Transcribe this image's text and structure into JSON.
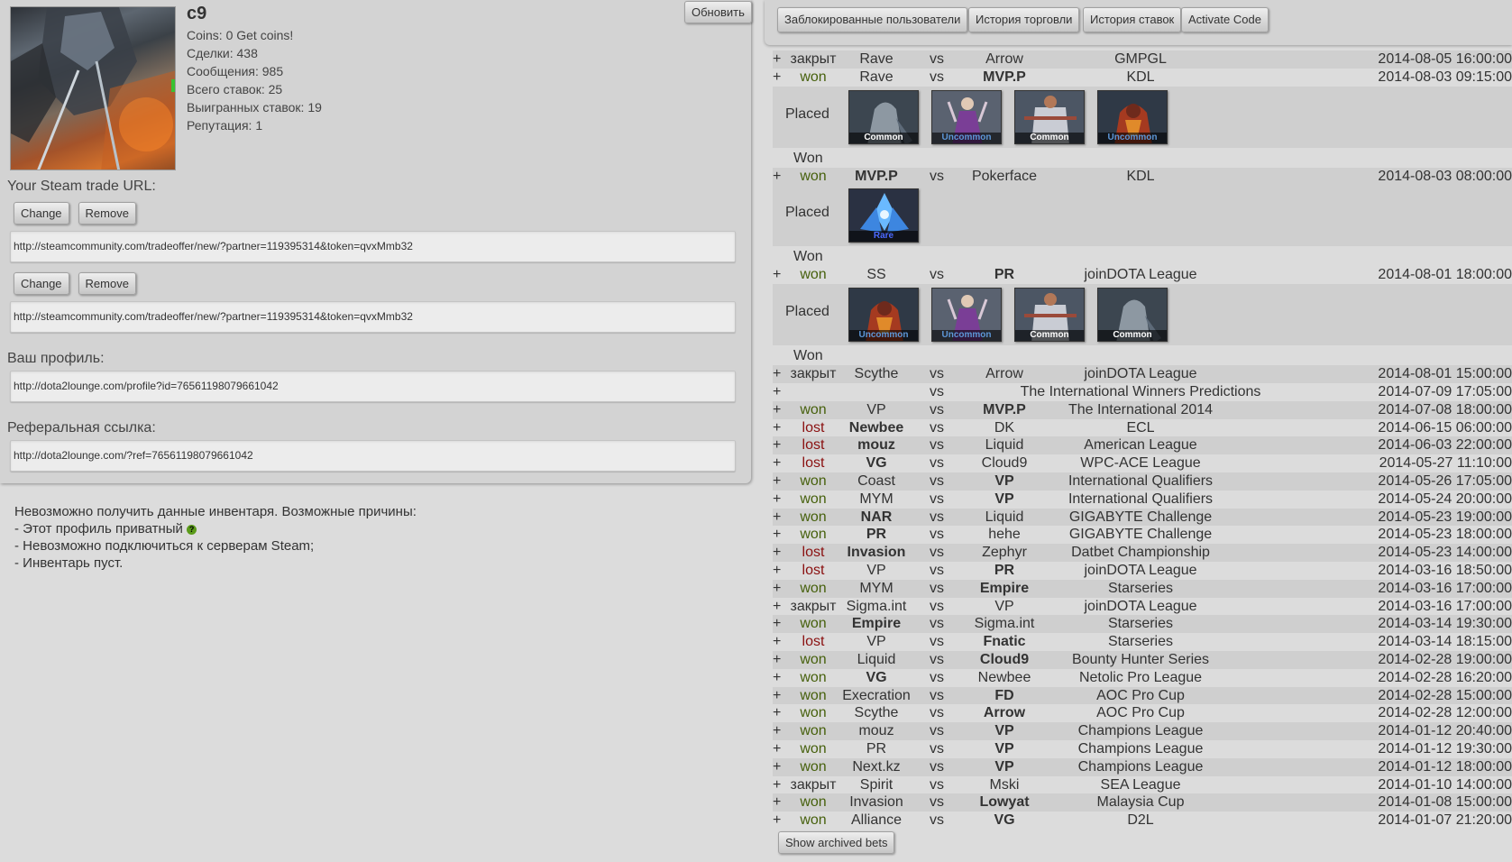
{
  "profile": {
    "username": "c9",
    "coins": "Coins: 0 Get coins!",
    "deals": "Сделки: 438",
    "messages": "Сообщения: 985",
    "total_bets": "Всего ставок: 25",
    "won_bets": "Выигранных ставок: 19",
    "reputation": "Репутация: 1",
    "refresh_label": "Обновить"
  },
  "trade": {
    "label": "Your Steam trade URL:",
    "change_label": "Change",
    "remove_label": "Remove",
    "url1": "http://steamcommunity.com/tradeoffer/new/?partner=119395314&token=qvxMmb32",
    "url2": "http://steamcommunity.com/tradeoffer/new/?partner=119395314&token=qvxMmb32"
  },
  "profile_link": {
    "label": "Ваш профиль:",
    "url": "http://dota2lounge.com/profile?id=76561198079661042"
  },
  "referral": {
    "label": "Реферальная ссылка:",
    "url": "http://dota2lounge.com/?ref=76561198079661042"
  },
  "inventory": {
    "line1": "Невозможно получить данные инвентаря. Возможные причины:",
    "line2": "- Этот профиль приватный",
    "line3": "- Невозможно подключиться к серверам Steam;",
    "line4": "- Инвентарь пуст."
  },
  "nav": {
    "blocked": "Заблокированные пользователи",
    "trade_history": "История торговли",
    "bet_history": "История ставок",
    "activate": "Activate Code"
  },
  "labels": {
    "placed": "Placed",
    "won": "Won",
    "vs": "vs",
    "plus": "+",
    "archived": "Show archived bets"
  },
  "colors": {
    "won": "#46600c",
    "lost": "#8a1010",
    "common": "#ffffff",
    "uncommon": "#5e98d9",
    "rare": "#4b69ff"
  },
  "bets": [
    {
      "status": "закрыт",
      "t1": "Rave",
      "t2": "Arrow",
      "league": "GMPGL",
      "date": "2014-08-05 16:00:00",
      "win": 0
    },
    {
      "status": "won",
      "t1": "Rave",
      "t2": "MVP.P",
      "league": "KDL",
      "date": "2014-08-03 09:15:00",
      "win": 2,
      "items": [
        {
          "rarity": "Common",
          "hero": "ghost"
        },
        {
          "rarity": "Uncommon",
          "hero": "purple"
        },
        {
          "rarity": "Common",
          "hero": "white"
        },
        {
          "rarity": "Uncommon",
          "hero": "red"
        }
      ]
    },
    {
      "status": "won",
      "t1": "MVP.P",
      "t2": "Pokerface",
      "league": "KDL",
      "date": "2014-08-03 08:00:00",
      "win": 1,
      "items": [
        {
          "rarity": "Rare",
          "hero": "blue"
        }
      ]
    },
    {
      "status": "won",
      "t1": "SS",
      "t2": "PR",
      "league": "joinDOTA League",
      "date": "2014-08-01 18:00:00",
      "win": 2,
      "items": [
        {
          "rarity": "Uncommon",
          "hero": "red"
        },
        {
          "rarity": "Uncommon",
          "hero": "purple"
        },
        {
          "rarity": "Common",
          "hero": "white"
        },
        {
          "rarity": "Common",
          "hero": "ghost"
        }
      ]
    },
    {
      "status": "закрыт",
      "t1": "Scythe",
      "t2": "Arrow",
      "league": "joinDOTA League",
      "date": "2014-08-01 15:00:00",
      "win": 0
    },
    {
      "status": "",
      "t1": "",
      "t2": "",
      "league": "The International Winners Predictions",
      "date": "2014-07-09 17:05:00",
      "win": 0
    },
    {
      "status": "won",
      "t1": "VP",
      "t2": "MVP.P",
      "league": "The International 2014",
      "date": "2014-07-08 18:00:00",
      "win": 2
    },
    {
      "status": "lost",
      "t1": "Newbee",
      "t2": "DK",
      "league": "ECL",
      "date": "2014-06-15 06:00:00",
      "win": 1
    },
    {
      "status": "lost",
      "t1": "mouz",
      "t2": "Liquid",
      "league": "American League",
      "date": "2014-06-03 22:00:00",
      "win": 1
    },
    {
      "status": "lost",
      "t1": "VG",
      "t2": "Cloud9",
      "league": "WPC-ACE League",
      "date": "2014-05-27 11:10:00",
      "win": 1
    },
    {
      "status": "won",
      "t1": "Coast",
      "t2": "VP",
      "league": "International Qualifiers",
      "date": "2014-05-26 17:05:00",
      "win": 2
    },
    {
      "status": "won",
      "t1": "MYM",
      "t2": "VP",
      "league": "International Qualifiers",
      "date": "2014-05-24 20:00:00",
      "win": 2
    },
    {
      "status": "won",
      "t1": "NAR",
      "t2": "Liquid",
      "league": "GIGABYTE Challenge",
      "date": "2014-05-23 19:00:00",
      "win": 1
    },
    {
      "status": "won",
      "t1": "PR",
      "t2": "hehe",
      "league": "GIGABYTE Challenge",
      "date": "2014-05-23 18:00:00",
      "win": 1
    },
    {
      "status": "lost",
      "t1": "Invasion",
      "t2": "Zephyr",
      "league": "Datbet Championship",
      "date": "2014-05-23 14:00:00",
      "win": 1
    },
    {
      "status": "lost",
      "t1": "VP",
      "t2": "PR",
      "league": "joinDOTA League",
      "date": "2014-03-16 18:50:00",
      "win": 2
    },
    {
      "status": "won",
      "t1": "MYM",
      "t2": "Empire",
      "league": "Starseries",
      "date": "2014-03-16 17:00:00",
      "win": 2
    },
    {
      "status": "закрыт",
      "t1": "Sigma.int",
      "t2": "VP",
      "league": "joinDOTA League",
      "date": "2014-03-16 17:00:00",
      "win": 0
    },
    {
      "status": "won",
      "t1": "Empire",
      "t2": "Sigma.int",
      "league": "Starseries",
      "date": "2014-03-14 19:30:00",
      "win": 1
    },
    {
      "status": "lost",
      "t1": "VP",
      "t2": "Fnatic",
      "league": "Starseries",
      "date": "2014-03-14 18:15:00",
      "win": 2
    },
    {
      "status": "won",
      "t1": "Liquid",
      "t2": "Cloud9",
      "league": "Bounty Hunter Series",
      "date": "2014-02-28 19:00:00",
      "win": 2
    },
    {
      "status": "won",
      "t1": "VG",
      "t2": "Newbee",
      "league": "Netolic Pro League",
      "date": "2014-02-28 16:20:00",
      "win": 1
    },
    {
      "status": "won",
      "t1": "Execration",
      "t2": "FD",
      "league": "AOC Pro Cup",
      "date": "2014-02-28 15:00:00",
      "win": 2
    },
    {
      "status": "won",
      "t1": "Scythe",
      "t2": "Arrow",
      "league": "AOC Pro Cup",
      "date": "2014-02-28 12:00:00",
      "win": 2
    },
    {
      "status": "won",
      "t1": "mouz",
      "t2": "VP",
      "league": "Champions League",
      "date": "2014-01-12 20:40:00",
      "win": 2
    },
    {
      "status": "won",
      "t1": "PR",
      "t2": "VP",
      "league": "Champions League",
      "date": "2014-01-12 19:30:00",
      "win": 2
    },
    {
      "status": "won",
      "t1": "Next.kz",
      "t2": "VP",
      "league": "Champions League",
      "date": "2014-01-12 18:00:00",
      "win": 2
    },
    {
      "status": "закрыт",
      "t1": "Spirit",
      "t2": "Mski",
      "league": "SEA League",
      "date": "2014-01-10 14:00:00",
      "win": 0
    },
    {
      "status": "won",
      "t1": "Invasion",
      "t2": "Lowyat",
      "league": "Malaysia Cup",
      "date": "2014-01-08 15:00:00",
      "win": 2
    },
    {
      "status": "won",
      "t1": "Alliance",
      "t2": "VG",
      "league": "D2L",
      "date": "2014-01-07 21:20:00",
      "win": 2
    }
  ]
}
